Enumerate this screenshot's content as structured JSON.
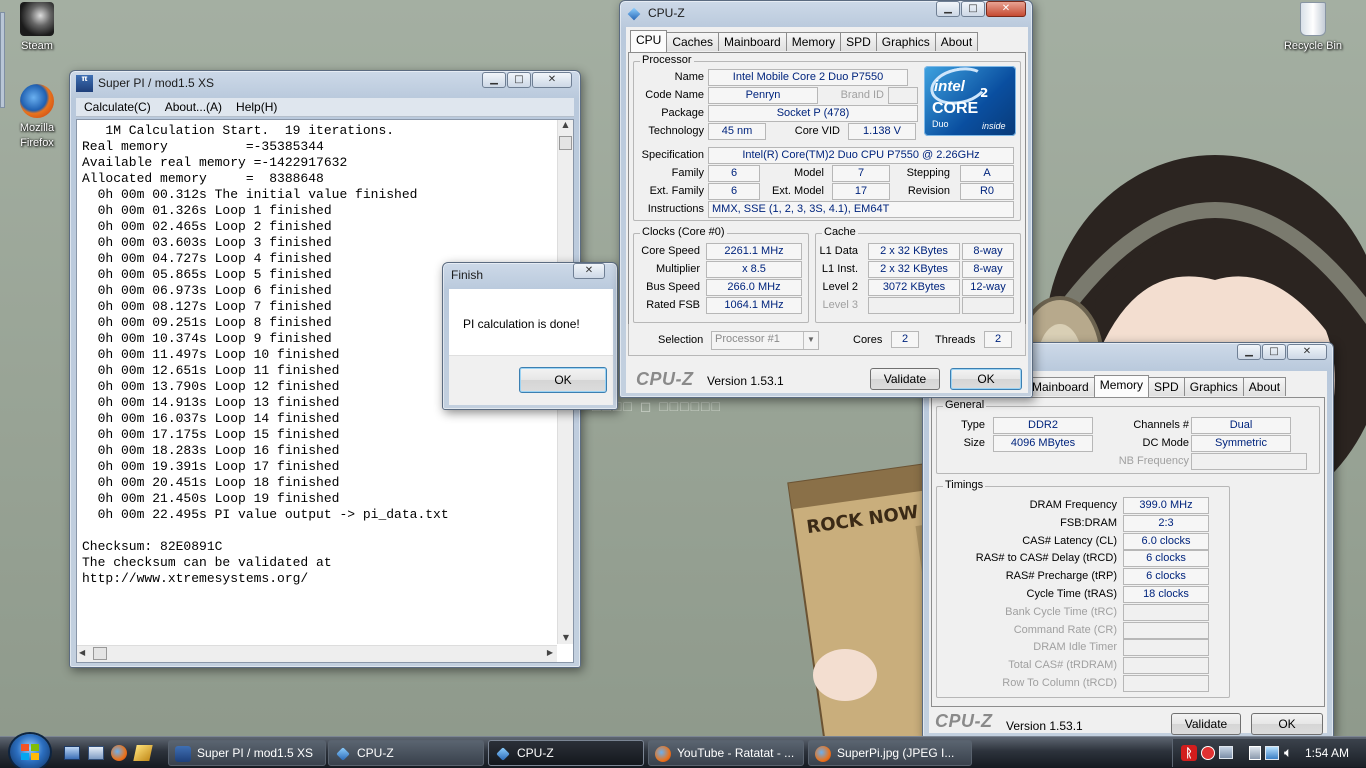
{
  "desktop": {
    "icons": [
      {
        "label": "Steam"
      },
      {
        "label": "Mozilla Firefox"
      },
      {
        "label": "Recycle Bin"
      }
    ],
    "wallpaper_text": "ROCK NOW",
    "wallpaper_jp": "ルネッサンス/プロローグ",
    "wallpaper_brand": "□□□□ ◻ □□□□□□"
  },
  "superpi": {
    "title": "Super PI / mod1.5 XS",
    "menu": [
      "Calculate(C)",
      "About...(A)",
      "Help(H)"
    ],
    "lines": [
      "   1M Calculation Start.  19 iterations.",
      "Real memory          =-35385344",
      "Available real memory =-1422917632",
      "Allocated memory     =  8388648",
      "  0h 00m 00.312s The initial value finished",
      "  0h 00m 01.326s Loop 1 finished",
      "  0h 00m 02.465s Loop 2 finished",
      "  0h 00m 03.603s Loop 3 finished",
      "  0h 00m 04.727s Loop 4 finished",
      "  0h 00m 05.865s Loop 5 finished",
      "  0h 00m 06.973s Loop 6 finished",
      "  0h 00m 08.127s Loop 7 finished",
      "  0h 00m 09.251s Loop 8 finished",
      "  0h 00m 10.374s Loop 9 finished",
      "  0h 00m 11.497s Loop 10 finished",
      "  0h 00m 12.651s Loop 11 finished",
      "  0h 00m 13.790s Loop 12 finished",
      "  0h 00m 14.913s Loop 13 finished",
      "  0h 00m 16.037s Loop 14 finished",
      "  0h 00m 17.175s Loop 15 finished",
      "  0h 00m 18.283s Loop 16 finished",
      "  0h 00m 19.391s Loop 17 finished",
      "  0h 00m 20.451s Loop 18 finished",
      "  0h 00m 21.450s Loop 19 finished",
      "  0h 00m 22.495s PI value output -> pi_data.txt",
      "",
      "Checksum: 82E0891C",
      "The checksum can be validated at",
      "http://www.xtremesystems.org/"
    ]
  },
  "finish_dialog": {
    "title": "Finish",
    "message": "PI calculation is done!",
    "ok_label": "OK"
  },
  "cpuz_cpu": {
    "title": "CPU-Z",
    "tabs": [
      "CPU",
      "Caches",
      "Mainboard",
      "Memory",
      "SPD",
      "Graphics",
      "About"
    ],
    "processor": {
      "group": "Processor",
      "name_label": "Name",
      "name": "Intel Mobile Core 2 Duo P7550",
      "codename_label": "Code Name",
      "codename": "Penryn",
      "brandid_label": "Brand ID",
      "brandid": "",
      "package_label": "Package",
      "package": "Socket P (478)",
      "technology_label": "Technology",
      "technology": "45 nm",
      "corevid_label": "Core VID",
      "corevid": "1.138 V",
      "spec_label": "Specification",
      "spec": "Intel(R) Core(TM)2 Duo CPU     P7550  @ 2.26GHz",
      "family_label": "Family",
      "family": "6",
      "model_label": "Model",
      "model": "7",
      "stepping_label": "Stepping",
      "stepping": "A",
      "extfamily_label": "Ext. Family",
      "extfamily": "6",
      "extmodel_label": "Ext. Model",
      "extmodel": "17",
      "revision_label": "Revision",
      "revision": "R0",
      "instr_label": "Instructions",
      "instr": "MMX, SSE (1, 2, 3, 3S, 4.1), EM64T"
    },
    "logo": {
      "brand": "intel",
      "line": "CORE",
      "sup": "2",
      "sub1": "Duo",
      "sub2": "inside"
    },
    "clocks": {
      "group": "Clocks (Core #0)",
      "core_speed_label": "Core Speed",
      "core_speed": "2261.1 MHz",
      "multiplier_label": "Multiplier",
      "multiplier": "x 8.5",
      "bus_speed_label": "Bus Speed",
      "bus_speed": "266.0 MHz",
      "rated_fsb_label": "Rated FSB",
      "rated_fsb": "1064.1 MHz"
    },
    "cache": {
      "group": "Cache",
      "l1d_label": "L1 Data",
      "l1d": "2 x 32 KBytes",
      "l1d_way": "8-way",
      "l1i_label": "L1 Inst.",
      "l1i": "2 x 32 KBytes",
      "l1i_way": "8-way",
      "l2_label": "Level 2",
      "l2": "3072 KBytes",
      "l2_way": "12-way",
      "l3_label": "Level 3"
    },
    "selection_label": "Selection",
    "selection": "Processor #1",
    "cores_label": "Cores",
    "cores": "2",
    "threads_label": "Threads",
    "threads": "2",
    "logo_text": "CPU-Z",
    "version": "Version 1.53.1",
    "validate_label": "Validate",
    "ok_label": "OK"
  },
  "cpuz_mem": {
    "tabs": [
      "Mainboard",
      "Memory",
      "SPD",
      "Graphics",
      "About"
    ],
    "general": {
      "group": "General",
      "type_label": "Type",
      "type": "DDR2",
      "size_label": "Size",
      "size": "4096 MBytes",
      "channels_label": "Channels #",
      "channels": "Dual",
      "dcmode_label": "DC Mode",
      "dcmode": "Symmetric",
      "nbfreq_label": "NB Frequency",
      "nbfreq": ""
    },
    "timings": {
      "group": "Timings",
      "rows": [
        {
          "label": "DRAM Frequency",
          "value": "399.0 MHz",
          "enabled": true
        },
        {
          "label": "FSB:DRAM",
          "value": "2:3",
          "enabled": true
        },
        {
          "label": "CAS# Latency (CL)",
          "value": "6.0 clocks",
          "enabled": true
        },
        {
          "label": "RAS# to CAS# Delay (tRCD)",
          "value": "6 clocks",
          "enabled": true
        },
        {
          "label": "RAS# Precharge (tRP)",
          "value": "6 clocks",
          "enabled": true
        },
        {
          "label": "Cycle Time (tRAS)",
          "value": "18 clocks",
          "enabled": true
        },
        {
          "label": "Bank Cycle Time (tRC)",
          "value": "",
          "enabled": false
        },
        {
          "label": "Command Rate (CR)",
          "value": "",
          "enabled": false
        },
        {
          "label": "DRAM Idle Timer",
          "value": "",
          "enabled": false
        },
        {
          "label": "Total CAS# (tRDRAM)",
          "value": "",
          "enabled": false
        },
        {
          "label": "Row To Column (tRCD)",
          "value": "",
          "enabled": false
        }
      ]
    },
    "logo_text": "CPU-Z",
    "version": "Version 1.53.1",
    "validate_label": "Validate",
    "ok_label": "OK"
  },
  "taskbar": {
    "tasks": [
      {
        "label": "Super PI / mod1.5 XS",
        "active": false
      },
      {
        "label": "CPU-Z",
        "active": false
      },
      {
        "label": "CPU-Z",
        "active": true
      },
      {
        "label": "YouTube - Ratatat - ...",
        "active": false
      },
      {
        "label": "SuperPi.jpg (JPEG I...",
        "active": false
      }
    ],
    "clock": "1:54 AM"
  },
  "colors": {
    "accent": "#00247d",
    "intel_blue": "#0860a8",
    "taskbar": "#1d232b"
  }
}
